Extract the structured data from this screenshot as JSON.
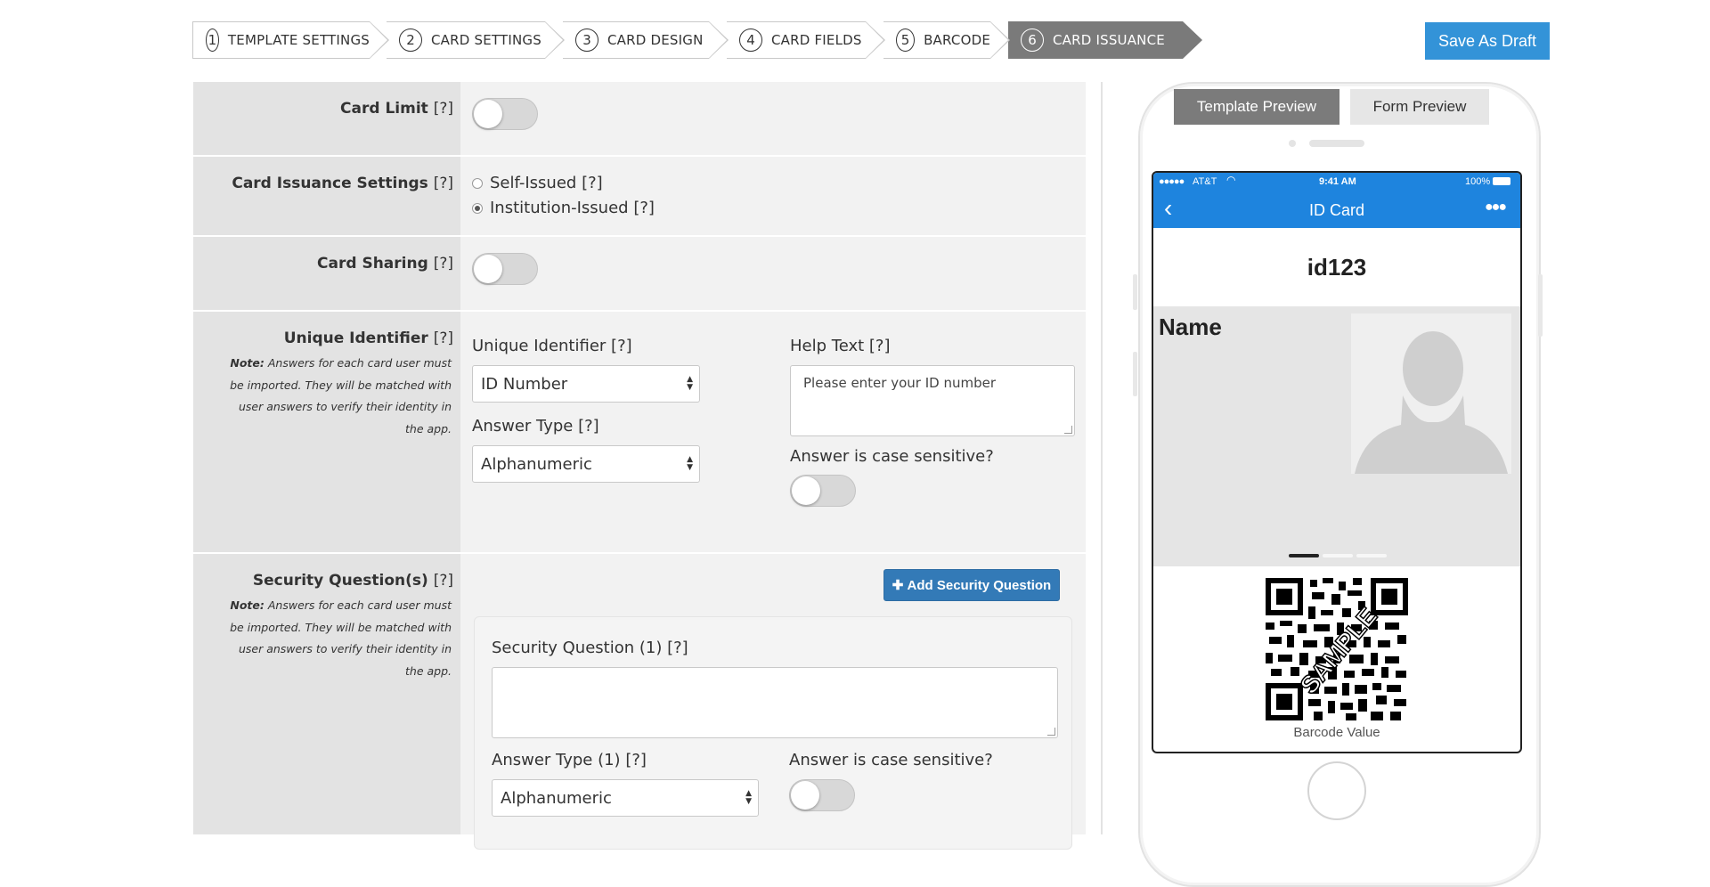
{
  "wizard": {
    "steps": [
      {
        "num": "1",
        "label": "TEMPLATE SETTINGS"
      },
      {
        "num": "2",
        "label": "CARD SETTINGS"
      },
      {
        "num": "3",
        "label": "CARD DESIGN"
      },
      {
        "num": "4",
        "label": "CARD FIELDS"
      },
      {
        "num": "5",
        "label": "BARCODE"
      },
      {
        "num": "6",
        "label": "CARD ISSUANCE"
      }
    ],
    "active_step": "6",
    "save_draft_label": "Save As Draft"
  },
  "form": {
    "help_marker": "[?]",
    "card_limit": {
      "label": "Card Limit",
      "enabled": false
    },
    "card_issuance": {
      "label": "Card Issuance Settings",
      "options": [
        "Self-Issued",
        "Institution-Issued"
      ],
      "selected": "Institution-Issued"
    },
    "card_sharing": {
      "label": "Card Sharing",
      "enabled": false
    },
    "unique_identifier": {
      "label": "Unique Identifier",
      "note_prefix": "Note:",
      "note_text": "Answers for each card user must be imported. They will be matched with user answers to verify their identity in the app.",
      "field_label": "Unique Identifier",
      "field_value": "ID Number",
      "help_text_label": "Help Text",
      "help_text_value": "Please enter your ID number",
      "answer_type_label": "Answer Type",
      "answer_type_value": "Alphanumeric",
      "case_sensitive_label": "Answer is case sensitive?",
      "case_sensitive": false
    },
    "security_questions": {
      "label": "Security Question(s)",
      "note_prefix": "Note:",
      "note_text": "Answers for each card user must be imported. They will be matched with user answers to verify their identity in the app.",
      "add_button_label": "Add Security Question",
      "question_label": "Security Question (1)",
      "question_value": "",
      "answer_type_label": "Answer Type (1)",
      "answer_type_value": "Alphanumeric",
      "case_sensitive_label": "Answer is case sensitive?",
      "case_sensitive": false
    }
  },
  "preview": {
    "tabs": [
      "Template Preview",
      "Form Preview"
    ],
    "active_tab": "Template Preview",
    "status": {
      "carrier": "AT&T",
      "time": "9:41 AM",
      "battery": "100%"
    },
    "nav_title": "ID Card",
    "card_id": "id123",
    "card_name": "Name",
    "barcode_label": "Barcode Value",
    "barcode_watermark": "SAMPLE"
  },
  "colors": {
    "primary": "#3393d8",
    "nav_blue": "#1e84de",
    "active_step": "#7a7a7a",
    "add_button": "#337ab7"
  }
}
